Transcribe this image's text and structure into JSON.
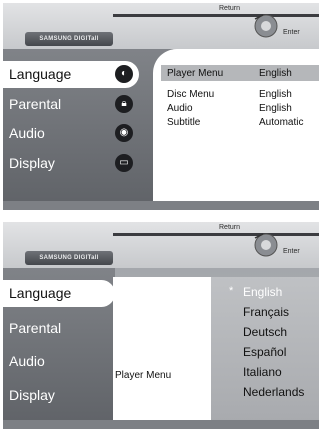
{
  "header": {
    "logo_text": "SAMSUNG DIGITall",
    "return_label": "Return",
    "enter_label": "Enter"
  },
  "screen1": {
    "menu": [
      {
        "label": "Language",
        "icon": "language-icon"
      },
      {
        "label": "Parental",
        "icon": "lock-icon"
      },
      {
        "label": "Audio",
        "icon": "audio-icon"
      },
      {
        "label": "Display",
        "icon": "display-icon"
      }
    ],
    "settings": [
      {
        "label": "Player Menu",
        "value": "English"
      },
      {
        "label": "Disc Menu",
        "value": "English"
      },
      {
        "label": "Audio",
        "value": "English"
      },
      {
        "label": "Subtitle",
        "value": "Automatic"
      }
    ]
  },
  "screen2": {
    "menu": [
      {
        "label": "Language"
      },
      {
        "label": "Parental"
      },
      {
        "label": "Audio"
      },
      {
        "label": "Display"
      }
    ],
    "submenu_label": "Player Menu",
    "languages": [
      "English",
      "Français",
      "Deutsch",
      "Español",
      "Italiano",
      "Nederlands"
    ],
    "selected_marker": "*"
  },
  "colors": {
    "menu_bg": "#6f7277",
    "panel_bg": "#ffffff",
    "highlight": "#b5b7ba",
    "icon_bg": "#1d1e21"
  }
}
